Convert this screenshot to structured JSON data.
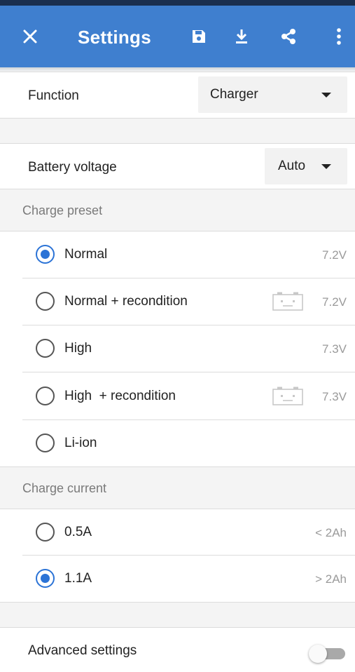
{
  "appbar": {
    "title": "Settings",
    "close_icon": "close-icon",
    "save_icon": "save-icon",
    "download_icon": "download-icon",
    "share_icon": "share-icon",
    "more_icon": "more-vert-icon",
    "color": "#3f7fcf"
  },
  "function": {
    "label": "Function",
    "value": "Charger"
  },
  "battery_voltage": {
    "label": "Battery voltage",
    "value": "Auto"
  },
  "charge_preset": {
    "title": "Charge preset",
    "options": [
      {
        "label": "Normal",
        "value": "7.2V",
        "selected": true,
        "recondition_icon": false
      },
      {
        "label": "Normal + recondition",
        "value": "7.2V",
        "selected": false,
        "recondition_icon": true
      },
      {
        "label": "High",
        "value": "7.3V",
        "selected": false,
        "recondition_icon": false
      },
      {
        "label": "High  + recondition",
        "value": "7.3V",
        "selected": false,
        "recondition_icon": true
      },
      {
        "label": "Li-ion",
        "value": "",
        "selected": false,
        "recondition_icon": false
      }
    ]
  },
  "charge_current": {
    "title": "Charge current",
    "options": [
      {
        "label": "0.5A",
        "value": "< 2Ah",
        "selected": false
      },
      {
        "label": "1.1A",
        "value": "> 2Ah",
        "selected": true
      }
    ]
  },
  "advanced": {
    "label": "Advanced settings",
    "enabled": false
  },
  "accent_color": "#2b73d6"
}
